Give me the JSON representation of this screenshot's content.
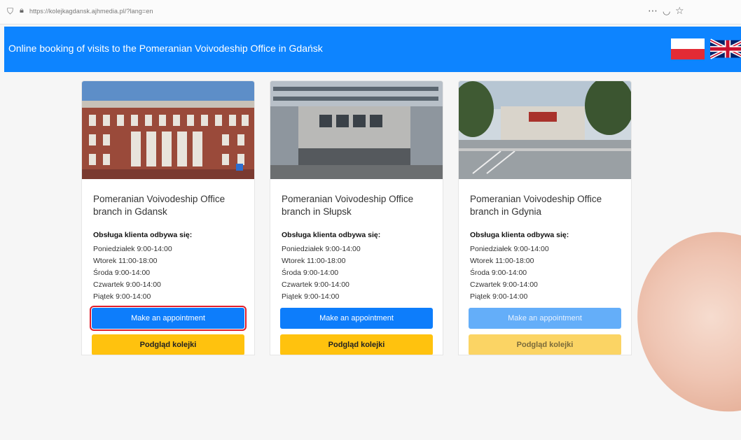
{
  "browser": {
    "url": "https://kolejkagdansk.ajhmedia.pl/?lang=en",
    "icons": [
      "shield-icon",
      "lock-icon",
      "more-icon",
      "pocket-icon",
      "star-icon"
    ]
  },
  "header": {
    "title": "Online booking of visits to the Pomeranian Voivodeship Office in Gdańsk",
    "flags": [
      "polish-flag",
      "uk-flag"
    ],
    "background": "#0d84ff"
  },
  "cards": [
    {
      "name": "Pomeranian Voivodeship Office branch in Gdansk",
      "hours_heading": "Obsługa klienta odbywa się:",
      "hours": [
        "Poniedziałek 9:00-14:00",
        "Wtorek 11:00-18:00",
        "Środa 9:00-14:00",
        "Czwartek 9:00-14:00",
        "Piątek 9:00-14:00"
      ],
      "appointment_label": "Make an appointment",
      "preview_label": "Podgląd kolejki",
      "enabled": true,
      "highlighted": true
    },
    {
      "name": "Pomeranian Voivodeship Office branch in Słupsk",
      "hours_heading": "Obsługa klienta odbywa się:",
      "hours": [
        "Poniedziałek 9:00-14:00",
        "Wtorek 11:00-18:00",
        "Środa 9:00-14:00",
        "Czwartek 9:00-14:00",
        "Piątek 9:00-14:00"
      ],
      "appointment_label": "Make an appointment",
      "preview_label": "Podgląd kolejki",
      "enabled": true,
      "highlighted": false
    },
    {
      "name": "Pomeranian Voivodeship Office branch in Gdynia",
      "hours_heading": "Obsługa klienta odbywa się:",
      "hours": [
        "Poniedziałek 9:00-14:00",
        "Wtorek 11:00-18:00",
        "Środa 9:00-14:00",
        "Czwartek 9:00-14:00",
        "Piątek 9:00-14:00"
      ],
      "appointment_label": "Make an appointment",
      "preview_label": "Podgląd kolejki",
      "enabled": false,
      "highlighted": false
    }
  ],
  "colors": {
    "primary": "#0d7dfb",
    "warning": "#ffc20e",
    "highlight_border": "#e11d2a"
  }
}
